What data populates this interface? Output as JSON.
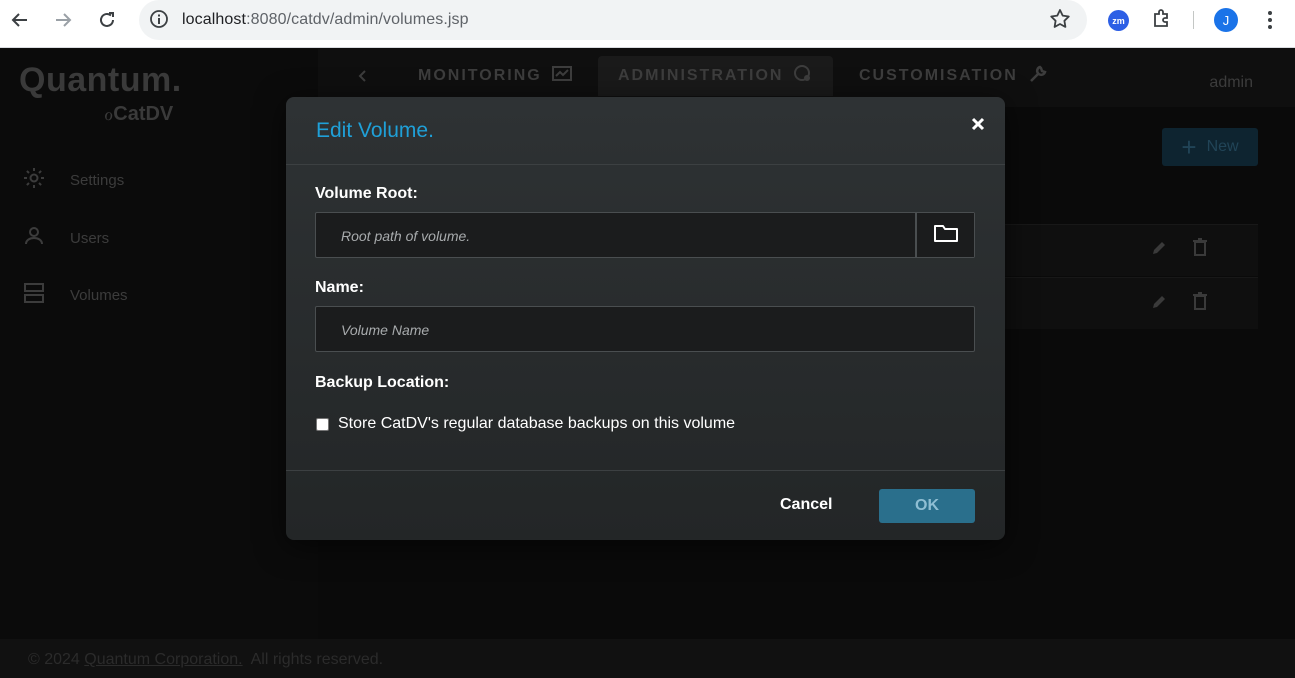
{
  "browser": {
    "url_host": "localhost",
    "url_path": ":8080/catdv/admin/volumes.jsp",
    "ext_zm": "zm",
    "profile_initial": "J"
  },
  "app": {
    "brand": "Quantum.",
    "product": "CatDV",
    "sidebar": {
      "items": [
        {
          "label": "Settings",
          "icon": "gear-icon"
        },
        {
          "label": "Users",
          "icon": "user-icon"
        },
        {
          "label": "Volumes",
          "icon": "server-icon"
        }
      ]
    },
    "tabs": [
      {
        "label": "MONITORING",
        "icon": "monitor-icon"
      },
      {
        "label": "ADMINISTRATION",
        "icon": "admin-gear-icon"
      },
      {
        "label": "CUSTOMISATION",
        "icon": "wrench-icon"
      }
    ],
    "user": "admin",
    "new_button": "New",
    "footer": {
      "prefix": "© 2024 ",
      "link": "Quantum Corporation.",
      "suffix": "  All rights reserved."
    }
  },
  "modal": {
    "title": "Edit Volume.",
    "volume_root_label": "Volume Root:",
    "volume_root_placeholder": "Root path of volume.",
    "name_label": "Name:",
    "name_placeholder": "Volume Name",
    "backup_label": "Backup Location:",
    "backup_checkbox": "Store CatDV's regular database backups on this volume",
    "backup_checked": false,
    "cancel": "Cancel",
    "ok": "OK"
  },
  "colors": {
    "accent": "#1fa0d8",
    "ok_button": "#2a6f8c"
  }
}
